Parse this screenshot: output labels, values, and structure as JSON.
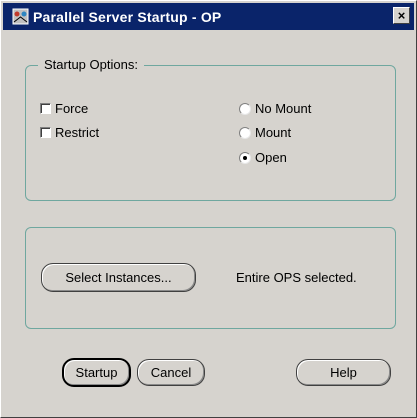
{
  "window": {
    "title": "Parallel Server Startup - OP"
  },
  "startup_options": {
    "legend": "Startup Options:",
    "checkboxes": [
      {
        "label": "Force",
        "checked": false
      },
      {
        "label": "Restrict",
        "checked": false
      }
    ],
    "radios": [
      {
        "label": "No Mount",
        "checked": false
      },
      {
        "label": "Mount",
        "checked": false
      },
      {
        "label": "Open",
        "checked": true
      }
    ]
  },
  "instances": {
    "select_button": "Select Instances...",
    "status": "Entire OPS selected."
  },
  "buttons": {
    "startup": "Startup",
    "cancel": "Cancel",
    "help": "Help"
  },
  "icons": {
    "window_icon": "app-window-icon",
    "close": "close-icon"
  }
}
